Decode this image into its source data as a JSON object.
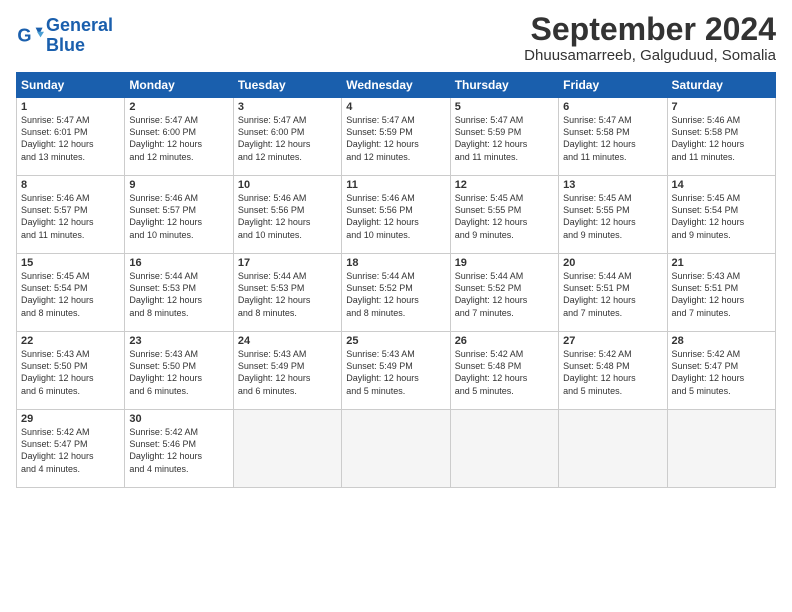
{
  "header": {
    "logo_line1": "General",
    "logo_line2": "Blue",
    "month": "September 2024",
    "location": "Dhuusamarreeb, Galguduud, Somalia"
  },
  "columns": [
    "Sunday",
    "Monday",
    "Tuesday",
    "Wednesday",
    "Thursday",
    "Friday",
    "Saturday"
  ],
  "weeks": [
    [
      {
        "day": "1",
        "info": "Sunrise: 5:47 AM\nSunset: 6:01 PM\nDaylight: 12 hours\nand 13 minutes."
      },
      {
        "day": "2",
        "info": "Sunrise: 5:47 AM\nSunset: 6:00 PM\nDaylight: 12 hours\nand 12 minutes."
      },
      {
        "day": "3",
        "info": "Sunrise: 5:47 AM\nSunset: 6:00 PM\nDaylight: 12 hours\nand 12 minutes."
      },
      {
        "day": "4",
        "info": "Sunrise: 5:47 AM\nSunset: 5:59 PM\nDaylight: 12 hours\nand 12 minutes."
      },
      {
        "day": "5",
        "info": "Sunrise: 5:47 AM\nSunset: 5:59 PM\nDaylight: 12 hours\nand 11 minutes."
      },
      {
        "day": "6",
        "info": "Sunrise: 5:47 AM\nSunset: 5:58 PM\nDaylight: 12 hours\nand 11 minutes."
      },
      {
        "day": "7",
        "info": "Sunrise: 5:46 AM\nSunset: 5:58 PM\nDaylight: 12 hours\nand 11 minutes."
      }
    ],
    [
      {
        "day": "8",
        "info": "Sunrise: 5:46 AM\nSunset: 5:57 PM\nDaylight: 12 hours\nand 11 minutes."
      },
      {
        "day": "9",
        "info": "Sunrise: 5:46 AM\nSunset: 5:57 PM\nDaylight: 12 hours\nand 10 minutes."
      },
      {
        "day": "10",
        "info": "Sunrise: 5:46 AM\nSunset: 5:56 PM\nDaylight: 12 hours\nand 10 minutes."
      },
      {
        "day": "11",
        "info": "Sunrise: 5:46 AM\nSunset: 5:56 PM\nDaylight: 12 hours\nand 10 minutes."
      },
      {
        "day": "12",
        "info": "Sunrise: 5:45 AM\nSunset: 5:55 PM\nDaylight: 12 hours\nand 9 minutes."
      },
      {
        "day": "13",
        "info": "Sunrise: 5:45 AM\nSunset: 5:55 PM\nDaylight: 12 hours\nand 9 minutes."
      },
      {
        "day": "14",
        "info": "Sunrise: 5:45 AM\nSunset: 5:54 PM\nDaylight: 12 hours\nand 9 minutes."
      }
    ],
    [
      {
        "day": "15",
        "info": "Sunrise: 5:45 AM\nSunset: 5:54 PM\nDaylight: 12 hours\nand 8 minutes."
      },
      {
        "day": "16",
        "info": "Sunrise: 5:44 AM\nSunset: 5:53 PM\nDaylight: 12 hours\nand 8 minutes."
      },
      {
        "day": "17",
        "info": "Sunrise: 5:44 AM\nSunset: 5:53 PM\nDaylight: 12 hours\nand 8 minutes."
      },
      {
        "day": "18",
        "info": "Sunrise: 5:44 AM\nSunset: 5:52 PM\nDaylight: 12 hours\nand 8 minutes."
      },
      {
        "day": "19",
        "info": "Sunrise: 5:44 AM\nSunset: 5:52 PM\nDaylight: 12 hours\nand 7 minutes."
      },
      {
        "day": "20",
        "info": "Sunrise: 5:44 AM\nSunset: 5:51 PM\nDaylight: 12 hours\nand 7 minutes."
      },
      {
        "day": "21",
        "info": "Sunrise: 5:43 AM\nSunset: 5:51 PM\nDaylight: 12 hours\nand 7 minutes."
      }
    ],
    [
      {
        "day": "22",
        "info": "Sunrise: 5:43 AM\nSunset: 5:50 PM\nDaylight: 12 hours\nand 6 minutes."
      },
      {
        "day": "23",
        "info": "Sunrise: 5:43 AM\nSunset: 5:50 PM\nDaylight: 12 hours\nand 6 minutes."
      },
      {
        "day": "24",
        "info": "Sunrise: 5:43 AM\nSunset: 5:49 PM\nDaylight: 12 hours\nand 6 minutes."
      },
      {
        "day": "25",
        "info": "Sunrise: 5:43 AM\nSunset: 5:49 PM\nDaylight: 12 hours\nand 5 minutes."
      },
      {
        "day": "26",
        "info": "Sunrise: 5:42 AM\nSunset: 5:48 PM\nDaylight: 12 hours\nand 5 minutes."
      },
      {
        "day": "27",
        "info": "Sunrise: 5:42 AM\nSunset: 5:48 PM\nDaylight: 12 hours\nand 5 minutes."
      },
      {
        "day": "28",
        "info": "Sunrise: 5:42 AM\nSunset: 5:47 PM\nDaylight: 12 hours\nand 5 minutes."
      }
    ],
    [
      {
        "day": "29",
        "info": "Sunrise: 5:42 AM\nSunset: 5:47 PM\nDaylight: 12 hours\nand 4 minutes."
      },
      {
        "day": "30",
        "info": "Sunrise: 5:42 AM\nSunset: 5:46 PM\nDaylight: 12 hours\nand 4 minutes."
      },
      {
        "day": "",
        "info": ""
      },
      {
        "day": "",
        "info": ""
      },
      {
        "day": "",
        "info": ""
      },
      {
        "day": "",
        "info": ""
      },
      {
        "day": "",
        "info": ""
      }
    ]
  ]
}
